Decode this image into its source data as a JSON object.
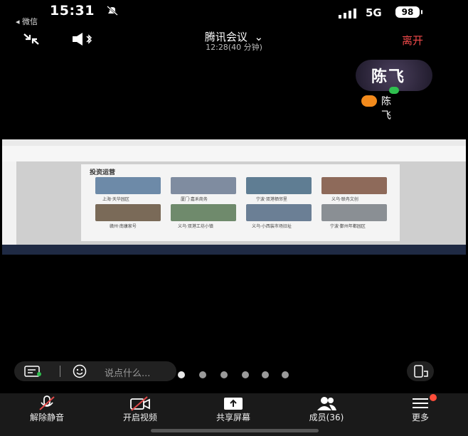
{
  "status": {
    "time": "15:31",
    "back_app": "◂ 微信",
    "network": "5G",
    "battery": "98"
  },
  "header": {
    "title": "腾讯会议",
    "subtitle": "12:28(40 分钟)",
    "leave_label": "离开"
  },
  "participant": {
    "name": "陈飞",
    "avatar_text": "陈飞"
  },
  "shared_screen": {
    "slide_title": "投资运营",
    "captions": [
      "上海·天华园区",
      "厦门·嘉禾商务",
      "宁波·双港栖邻里",
      "义乌·联冉文创",
      "赣州·南康家号",
      "义乌·双港工坊小镇",
      "义乌·小西装市场旧址",
      "宁波·鄞州年都园区"
    ]
  },
  "chat": {
    "placeholder": "说点什么..."
  },
  "toolbar": {
    "unmute": "解除静音",
    "video": "开启视频",
    "share": "共享屏幕",
    "members": "成员(36)",
    "more": "更多"
  },
  "colors": {
    "leave": "#f04a4a",
    "green": "#2fbf4f",
    "orange": "#f28a1c"
  }
}
